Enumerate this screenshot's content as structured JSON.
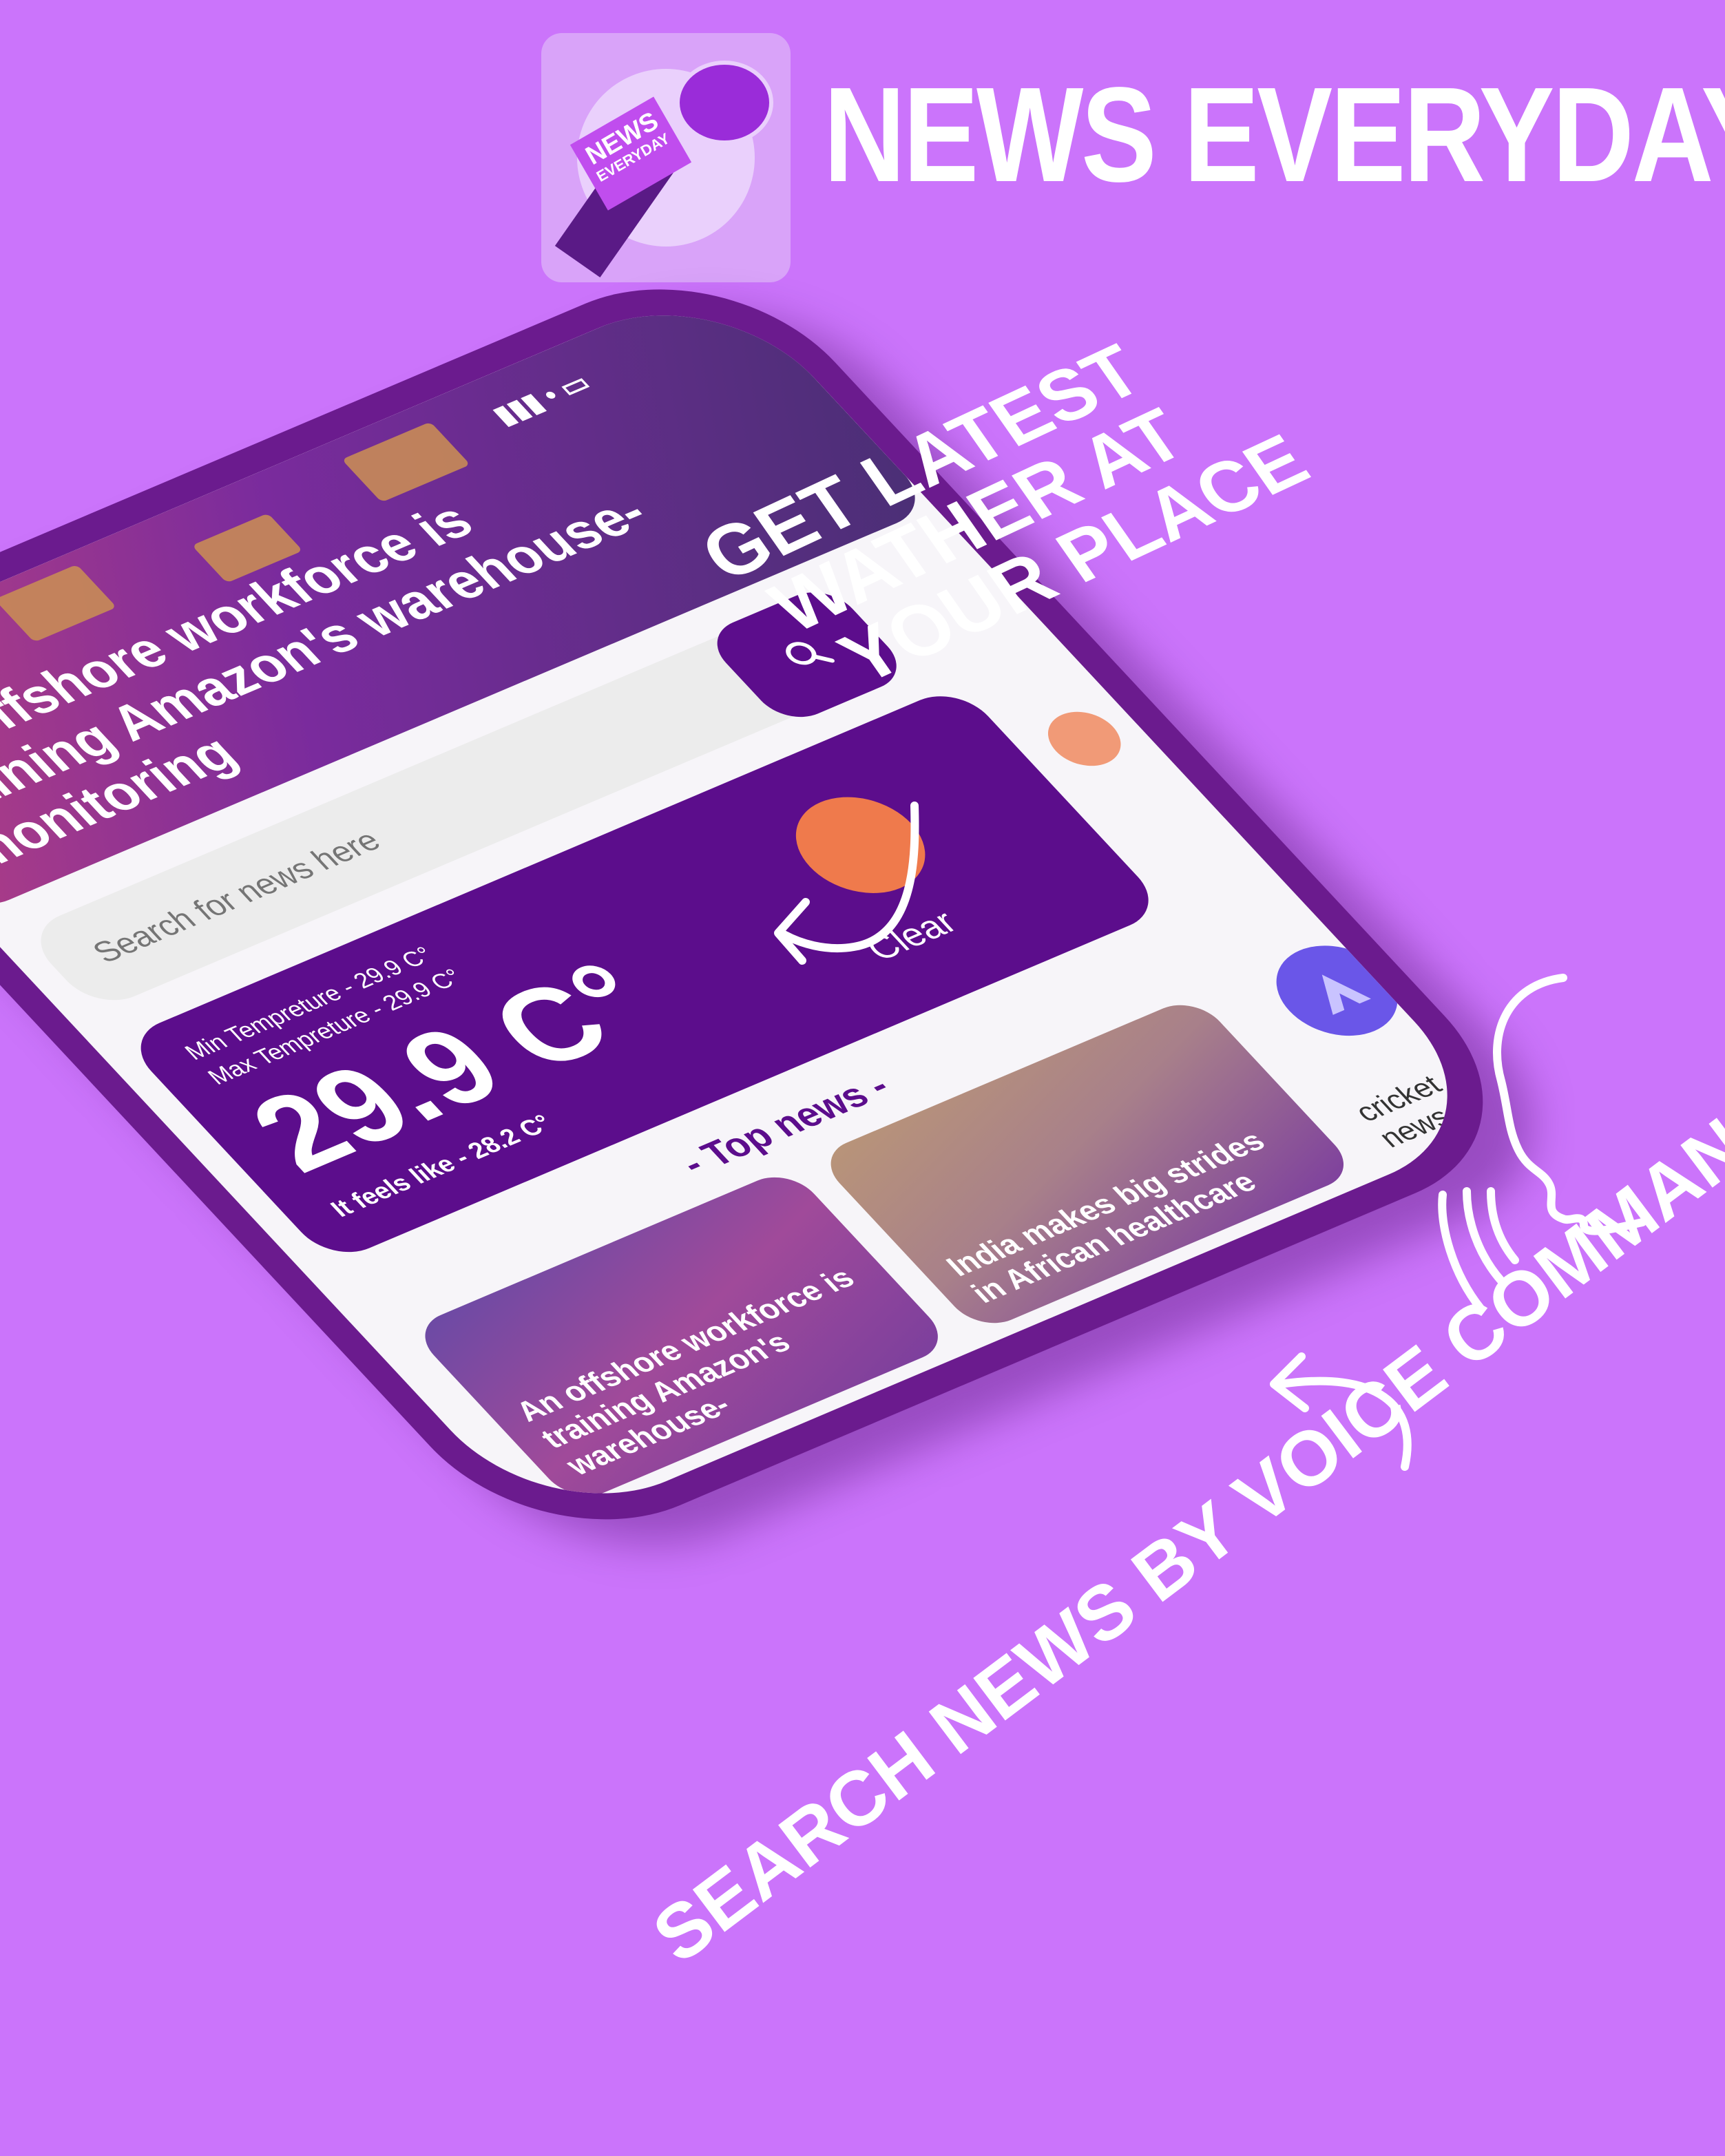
{
  "brand": {
    "app_name": "NEWS EVERYDAY",
    "icon_text_top": "NEWS",
    "icon_text_bottom": "EVERYDAY",
    "background_color": "#cb74fb",
    "accent_color": "#5c0d8c"
  },
  "app": {
    "hero_headline": "An offshore workforce is training Amazon's warehouse-monitoring",
    "status_icons": "▮▮▮ • ▭",
    "search": {
      "placeholder": "Search for news here",
      "search_icon": "search-icon"
    },
    "weather": {
      "min_temp": "Min Tempreture - 29.9 C°",
      "max_temp": "Max Tempreture - 29.9 C°",
      "current_temp": "29.9 C°",
      "feels_like": "It feels like - 28.2 C°",
      "description": "Clear",
      "icon": "sun-icon"
    },
    "top_news_title": "- Top news -",
    "news_cards": [
      {
        "caption": "An offshore workforce is training Amazon's warehouse-"
      },
      {
        "caption": "India makes big strides in African healthcare"
      }
    ],
    "category_label": "cricket news",
    "voice_button_icon": "voice-assistant-icon"
  },
  "callouts": {
    "weather": [
      "GET LATEST",
      "WATHER AT",
      "YOUR PLACE"
    ],
    "voice": "SEARCH NEWS BY VOICE COMMANDS"
  }
}
